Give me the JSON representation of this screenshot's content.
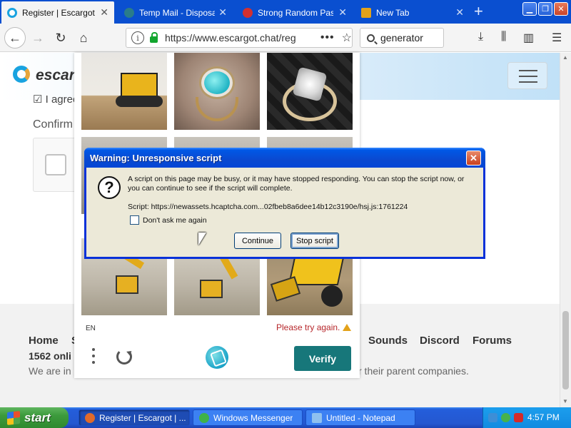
{
  "browser": {
    "tabs": [
      {
        "label": "Register | Escargot | E",
        "active": true,
        "favicon_color": "#1aa3e0"
      },
      {
        "label": "Temp Mail - Disposable",
        "active": false,
        "favicon_color": "#2a7c8a"
      },
      {
        "label": "Strong Random Passw",
        "active": false,
        "favicon_color": "#d33030"
      },
      {
        "label": "New Tab",
        "active": false,
        "favicon_color": "#e3a21a"
      }
    ],
    "url": "https://www.escargot.chat/reg",
    "search_value": "generator"
  },
  "page": {
    "logo_text": "escargot",
    "agree_text": "I agree",
    "confirm_label": "Confirm",
    "footer": {
      "links": [
        "Home",
        "S",
        "Sounds",
        "Discord",
        "Forums"
      ],
      "online": "1562 onli",
      "note_left": "We are in",
      "note_right": "r their parent companies."
    }
  },
  "captcha": {
    "language": "EN",
    "error": "Please try again.",
    "verify_label": "Verify"
  },
  "dialog": {
    "title": "Warning: Unresponsive script",
    "message": "A script on this page may be busy, or it may have stopped responding. You can stop the script now, or you can continue to see if the script will complete.",
    "script": "Script: https://newassets.hcaptcha.com...02fbeb8a6dee14b12c3190e/hsj.js:1761224",
    "checkbox_label": "Don't ask me again",
    "checked": false,
    "continue_label": "Continue",
    "stop_label": "Stop script"
  },
  "taskbar": {
    "start_label": "start",
    "tasks": [
      {
        "label": "Register | Escargot | ...",
        "active": true,
        "icon_color": "#e06a2a"
      },
      {
        "label": "Windows Messenger",
        "active": false,
        "icon_color": "#3fb24a"
      },
      {
        "label": "Untitled - Notepad",
        "active": false,
        "icon_color": "#8fc0ef"
      }
    ],
    "clock": "4:57 PM"
  }
}
